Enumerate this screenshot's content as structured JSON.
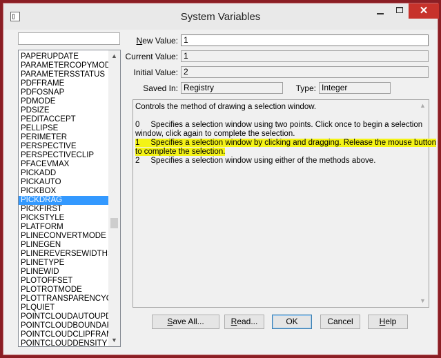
{
  "window": {
    "title": "System Variables"
  },
  "search": {
    "value": ""
  },
  "variables": [
    "PAPERUPDATE",
    "PARAMETERCOPYMODE",
    "PARAMETERSSTATUS",
    "PDFFRAME",
    "PDFOSNAP",
    "PDMODE",
    "PDSIZE",
    "PEDITACCEPT",
    "PELLIPSE",
    "PERIMETER",
    "PERSPECTIVE",
    "PERSPECTIVECLIP",
    "PFACEVMAX",
    "PICKADD",
    "PICKAUTO",
    "PICKBOX",
    "PICKDRAG",
    "PICKFIRST",
    "PICKSTYLE",
    "PLATFORM",
    "PLINECONVERTMODE",
    "PLINEGEN",
    "PLINEREVERSEWIDTHS",
    "PLINETYPE",
    "PLINEWID",
    "PLOTOFFSET",
    "PLOTROTMODE",
    "PLOTTRANSPARENCYOV",
    "PLQUIET",
    "POINTCLOUDAUTOUPDA",
    "POINTCLOUDBOUNDARY",
    "POINTCLOUDCLIPFRAME",
    "POINTCLOUDDENSITY"
  ],
  "selected_variable": "PICKDRAG",
  "fields": {
    "new_value": {
      "label_first": "N",
      "label_rest": "ew Value:",
      "value": "1"
    },
    "current_value": {
      "label": "Current Value:",
      "value": "1"
    },
    "initial_value": {
      "label": "Initial Value:",
      "value": "2"
    },
    "saved_in": {
      "label": "Saved In:",
      "value": "Registry"
    },
    "type": {
      "label": "Type:",
      "value": "Integer"
    }
  },
  "description": {
    "summary": "Controls the method of drawing a selection window.",
    "option0_line1": "0     Specifies a selection window using two points. Click once to begin a selection",
    "option0_line2": "window, click again to complete the selection.",
    "option1_line1": "1     Specifies a selection window by clicking and dragging. Release the mouse button",
    "option1_line2": "to complete the selection.",
    "option2": "2     Specifies a selection window using either of the methods above."
  },
  "buttons": {
    "save_all": {
      "u": "S",
      "rest": "ave All..."
    },
    "read": {
      "u": "R",
      "rest": "ead..."
    },
    "ok": {
      "label": "OK"
    },
    "cancel": {
      "label": "Cancel"
    },
    "help": {
      "u": "H",
      "rest": "elp"
    }
  },
  "colors": {
    "highlight": "#f4f316",
    "selection": "#3399ff",
    "close": "#c7322b",
    "border": "#8b1e24"
  }
}
